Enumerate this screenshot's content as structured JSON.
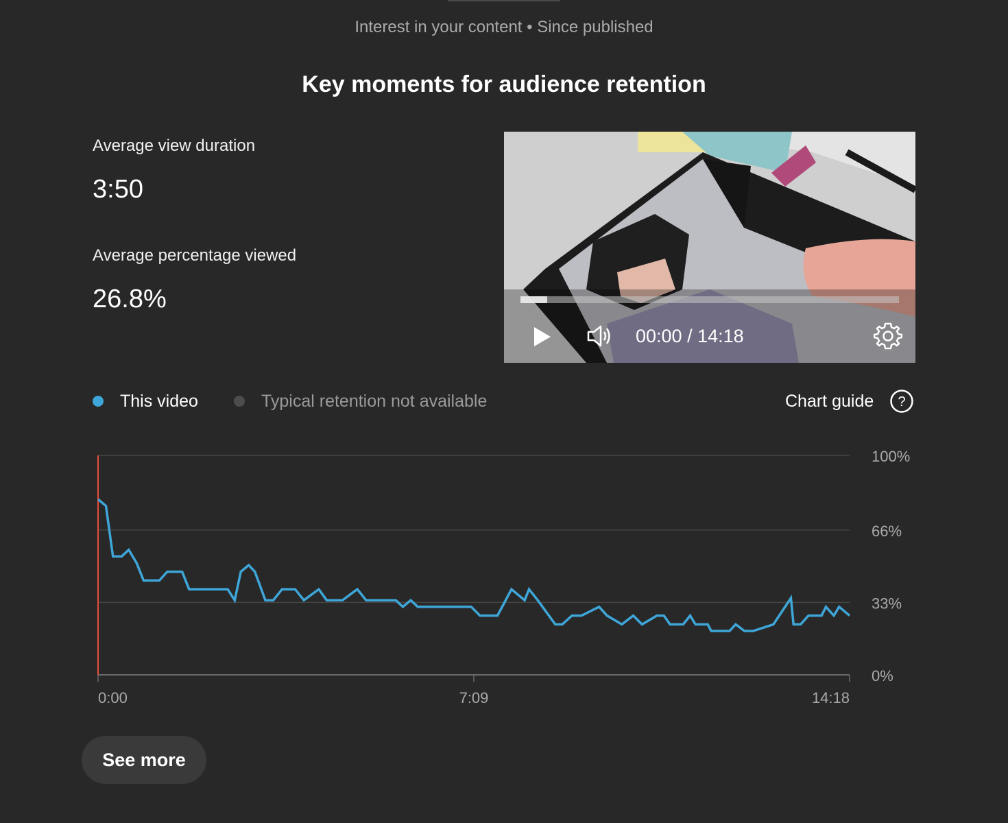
{
  "header": {
    "subtitle": "Interest in your content • Since published",
    "title": "Key moments for audience retention"
  },
  "metrics": {
    "avg_view_duration_label": "Average view duration",
    "avg_view_duration_value": "3:50",
    "avg_percentage_label": "Average percentage viewed",
    "avg_percentage_value": "26.8%"
  },
  "player": {
    "time_display": "00:00 / 14:18",
    "progress_fraction": 0.07,
    "icons": [
      "play-icon",
      "volume-icon",
      "settings-gear-icon"
    ]
  },
  "legend": {
    "this_video": "This video",
    "typical": "Typical retention not available",
    "chart_guide": "Chart guide",
    "this_video_color": "#3ea6d8",
    "typical_color": "#4d4d4d"
  },
  "chart_data": {
    "type": "line",
    "ylim": [
      0,
      100
    ],
    "yticks": [
      "100%",
      "66%",
      "33%",
      "0%"
    ],
    "xticks": [
      "0:00",
      "7:09",
      "14:18"
    ],
    "x_range_seconds": [
      0,
      858
    ],
    "line_color": "#3ea6d8",
    "marker_color": "#e74c3c",
    "grid": true,
    "series": [
      {
        "name": "This video",
        "x": [
          0,
          9,
          17,
          27,
          35,
          44,
          52,
          70,
          79,
          96,
          104,
          148,
          156,
          163,
          172,
          179,
          191,
          200,
          210,
          225,
          235,
          252,
          261,
          270,
          279,
          296,
          306,
          323,
          340,
          348,
          357,
          365,
          375,
          426,
          436,
          456,
          464,
          472,
          487,
          492,
          502,
          522,
          530,
          541,
          549,
          552,
          572,
          581,
          598,
          611,
          621,
          638,
          646,
          653,
          668,
          676,
          682,
          696,
          700,
          706,
          721,
          728,
          738,
          748,
          771,
          791,
          794,
          802,
          811,
          826,
          831,
          840,
          846,
          858
        ],
        "y": [
          80,
          77,
          54,
          54,
          57,
          51,
          43,
          43,
          47,
          47,
          39,
          39,
          34,
          47,
          50,
          47,
          34,
          34,
          39,
          39,
          34,
          39,
          34,
          34,
          34,
          39,
          34,
          34,
          34,
          31,
          34,
          31,
          31,
          31,
          27,
          27,
          33,
          39,
          34,
          39,
          34,
          23,
          23,
          27,
          27,
          27,
          31,
          27,
          23,
          27,
          23,
          27,
          27,
          23,
          23,
          27,
          23,
          23,
          20,
          20,
          20,
          23,
          20,
          20,
          23,
          35,
          23,
          23,
          27,
          27,
          31,
          27,
          31,
          27
        ]
      }
    ]
  },
  "actions": {
    "see_more": "See more"
  }
}
